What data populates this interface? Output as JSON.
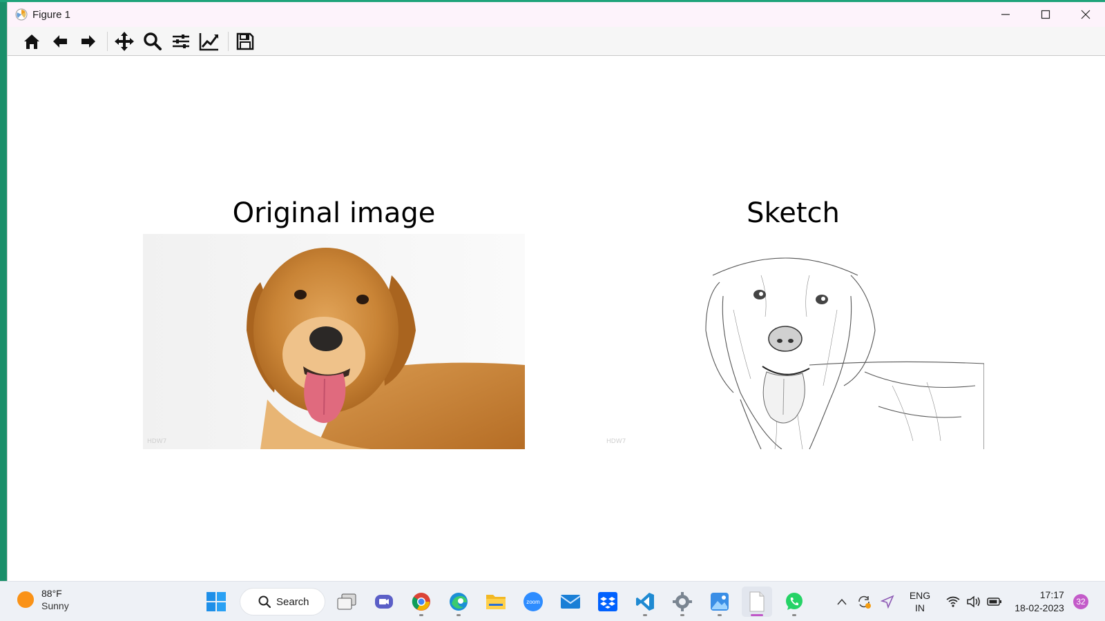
{
  "window": {
    "title": "Figure 1"
  },
  "figure": {
    "left_title": "Original image",
    "right_title": "Sketch",
    "watermark": "HDW7"
  },
  "taskbar": {
    "weather": {
      "temp": "88°F",
      "condition": "Sunny"
    },
    "search_label": "Search",
    "language": {
      "line1": "ENG",
      "line2": "IN"
    },
    "clock": {
      "time": "17:17",
      "date": "18-02-2023"
    },
    "notifications": "32"
  },
  "colors": {
    "accent": "#c058c8",
    "titlebar": "#fdf3fb",
    "taskbar": "#eef1f6",
    "green_bg": "#1a8f6a"
  }
}
